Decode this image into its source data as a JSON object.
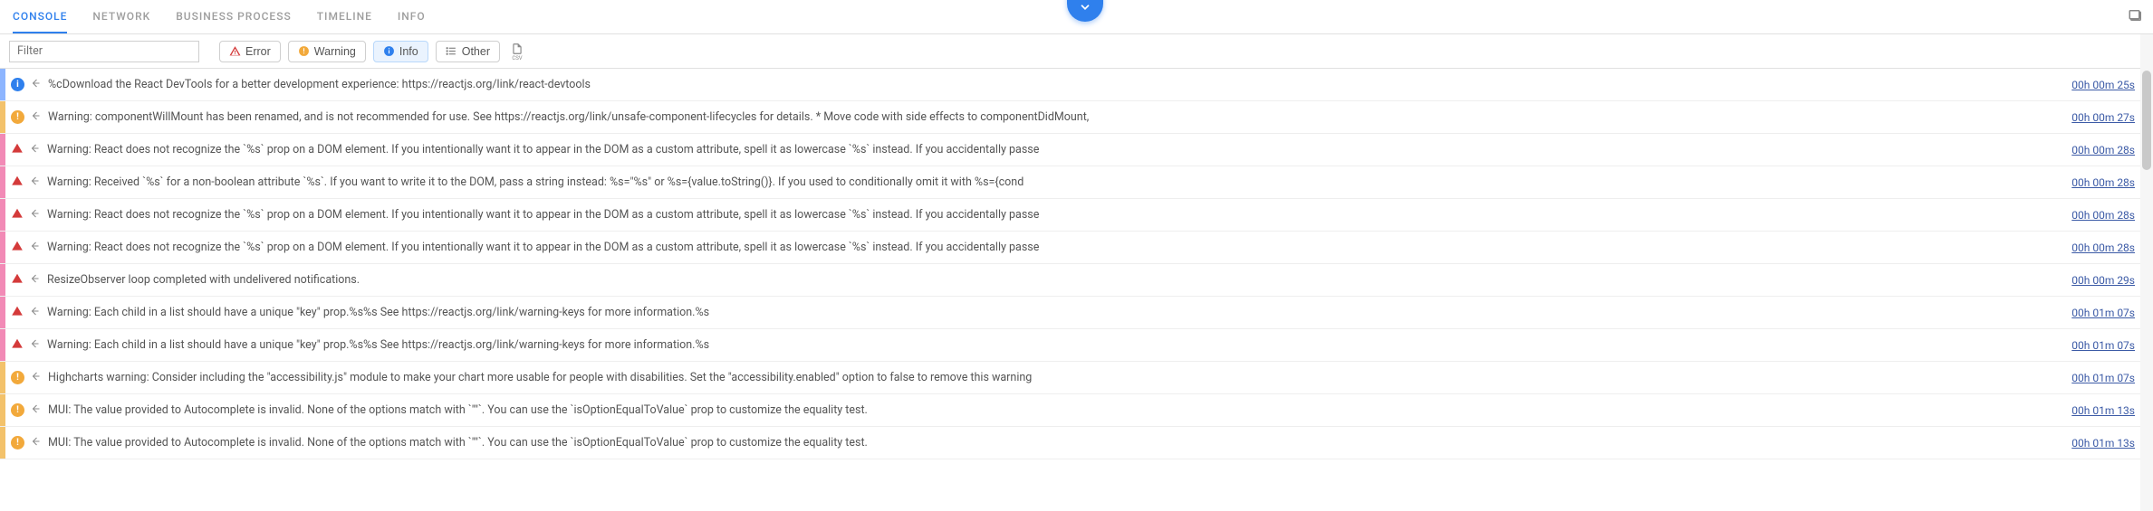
{
  "header": {
    "tabs": [
      "CONSOLE",
      "NETWORK",
      "BUSINESS PROCESS",
      "TIMELINE",
      "INFO"
    ],
    "active_tab": 0
  },
  "toolbar": {
    "filter_placeholder": "Filter",
    "buttons": {
      "error": "Error",
      "warning": "Warning",
      "info": "Info",
      "other": "Other"
    },
    "active_button": "info"
  },
  "logs": [
    {
      "level": "info",
      "msg": "%cDownload the React DevTools for a better development experience: https://reactjs.org/link/react-devtools",
      "time": "00h 00m 25s"
    },
    {
      "level": "warn",
      "msg": "Warning: componentWillMount has been renamed, and is not recommended for use. See https://reactjs.org/link/unsafe-component-lifecycles for details. * Move code with side effects to componentDidMount,",
      "time": "00h 00m 27s"
    },
    {
      "level": "err",
      "msg": "Warning: React does not recognize the `%s` prop on a DOM element. If you intentionally want it to appear in the DOM as a custom attribute, spell it as lowercase `%s` instead. If you accidentally passe",
      "time": "00h 00m 28s"
    },
    {
      "level": "err",
      "msg": "Warning: Received `%s` for a non-boolean attribute `%s`. If you want to write it to the DOM, pass a string instead: %s=\"%s\" or %s={value.toString()}. If you used to conditionally omit it with %s={cond",
      "time": "00h 00m 28s"
    },
    {
      "level": "err",
      "msg": "Warning: React does not recognize the `%s` prop on a DOM element. If you intentionally want it to appear in the DOM as a custom attribute, spell it as lowercase `%s` instead. If you accidentally passe",
      "time": "00h 00m 28s"
    },
    {
      "level": "err",
      "msg": "Warning: React does not recognize the `%s` prop on a DOM element. If you intentionally want it to appear in the DOM as a custom attribute, spell it as lowercase `%s` instead. If you accidentally passe",
      "time": "00h 00m 28s"
    },
    {
      "level": "err",
      "msg": "ResizeObserver loop completed with undelivered notifications.",
      "time": "00h 00m 29s"
    },
    {
      "level": "err",
      "msg": "Warning: Each child in a list should have a unique \"key\" prop.%s%s See https://reactjs.org/link/warning-keys for more information.%s",
      "time": "00h 01m 07s"
    },
    {
      "level": "err",
      "msg": "Warning: Each child in a list should have a unique \"key\" prop.%s%s See https://reactjs.org/link/warning-keys for more information.%s",
      "time": "00h 01m 07s"
    },
    {
      "level": "warn",
      "msg": "Highcharts warning: Consider including the \"accessibility.js\" module to make your chart more usable for people with disabilities. Set the \"accessibility.enabled\" option to false to remove this warning",
      "time": "00h 01m 07s"
    },
    {
      "level": "warn",
      "msg": "MUI: The value provided to Autocomplete is invalid. None of the options match with `\"\"`. You can use the `isOptionEqualToValue` prop to customize the equality test.",
      "time": "00h 01m 13s"
    },
    {
      "level": "warn",
      "msg": "MUI: The value provided to Autocomplete is invalid. None of the options match with `\"\"`. You can use the `isOptionEqualToValue` prop to customize the equality test.",
      "time": "00h 01m 13s"
    }
  ]
}
